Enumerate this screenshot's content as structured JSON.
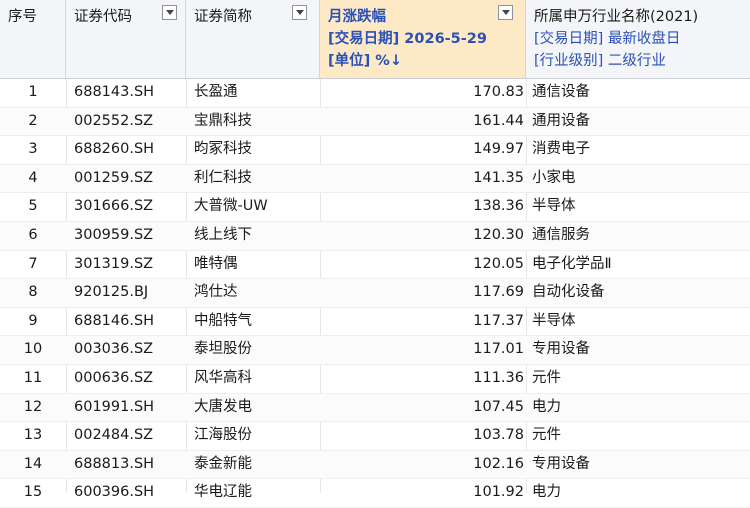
{
  "headers": {
    "seq": "序号",
    "code": "证券代码",
    "name": "证券简称",
    "chg_line1": "月涨跌幅",
    "chg_line2": "[交易日期] 2026-5-29",
    "chg_line3": "[单位] %↓",
    "ind_line1": "所属申万行业名称(2021)",
    "ind_line2": "[交易日期] 最新收盘日",
    "ind_line3": "[行业级别] 二级行业"
  },
  "rows": [
    {
      "seq": "1",
      "code": "688143.SH",
      "name": "长盈通",
      "chg": "170.83",
      "ind": "通信设备"
    },
    {
      "seq": "2",
      "code": "002552.SZ",
      "name": "宝鼎科技",
      "chg": "161.44",
      "ind": "通用设备"
    },
    {
      "seq": "3",
      "code": "688260.SH",
      "name": "昀冢科技",
      "chg": "149.97",
      "ind": "消费电子"
    },
    {
      "seq": "4",
      "code": "001259.SZ",
      "name": "利仁科技",
      "chg": "141.35",
      "ind": "小家电"
    },
    {
      "seq": "5",
      "code": "301666.SZ",
      "name": "大普微-UW",
      "chg": "138.36",
      "ind": "半导体"
    },
    {
      "seq": "6",
      "code": "300959.SZ",
      "name": "线上线下",
      "chg": "120.30",
      "ind": "通信服务"
    },
    {
      "seq": "7",
      "code": "301319.SZ",
      "name": "唯特偶",
      "chg": "120.05",
      "ind": "电子化学品Ⅱ"
    },
    {
      "seq": "8",
      "code": "920125.BJ",
      "name": "鸿仕达",
      "chg": "117.69",
      "ind": "自动化设备"
    },
    {
      "seq": "9",
      "code": "688146.SH",
      "name": "中船特气",
      "chg": "117.37",
      "ind": "半导体"
    },
    {
      "seq": "10",
      "code": "003036.SZ",
      "name": "泰坦股份",
      "chg": "117.01",
      "ind": "专用设备"
    },
    {
      "seq": "11",
      "code": "000636.SZ",
      "name": "风华高科",
      "chg": "111.36",
      "ind": "元件"
    },
    {
      "seq": "12",
      "code": "601991.SH",
      "name": "大唐发电",
      "chg": "107.45",
      "ind": "电力"
    },
    {
      "seq": "13",
      "code": "002484.SZ",
      "name": "江海股份",
      "chg": "103.78",
      "ind": "元件"
    },
    {
      "seq": "14",
      "code": "688813.SH",
      "name": "泰金新能",
      "chg": "102.16",
      "ind": "专用设备"
    },
    {
      "seq": "15",
      "code": "600396.SH",
      "name": "华电辽能",
      "chg": "101.92",
      "ind": "电力"
    }
  ]
}
